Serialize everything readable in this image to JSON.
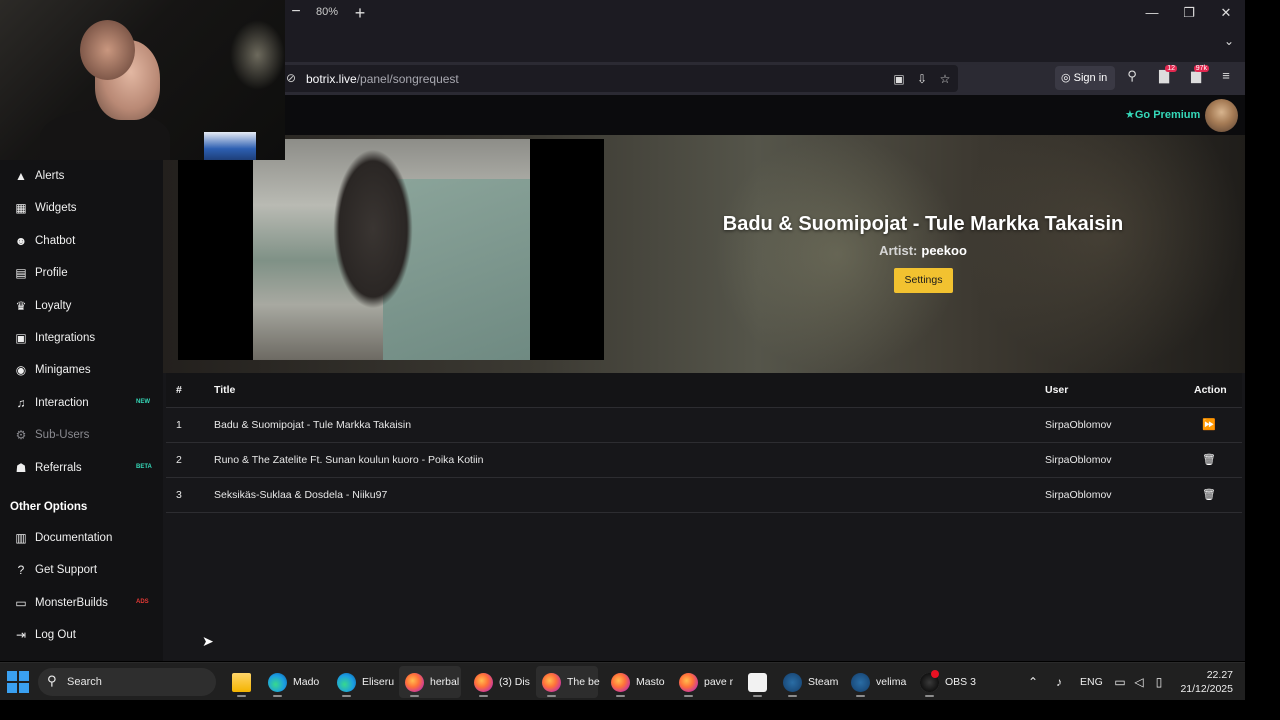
{
  "browser": {
    "zoom": {
      "minus": "−",
      "level": "80%",
      "plus": "+"
    },
    "window_controls": {
      "minimize": "—",
      "restore": "❐",
      "close": "✕"
    },
    "url": {
      "host": "botrix.live",
      "path": "/panel/songrequest"
    },
    "signin_label": "Sign in",
    "badges": {
      "notifications": "12",
      "twitch": "97k"
    }
  },
  "site": {
    "go_premium": "Go Premium"
  },
  "sidebar": {
    "items": [
      {
        "label": "Alerts",
        "icon": "warning-icon",
        "glyph": "▲"
      },
      {
        "label": "Widgets",
        "icon": "widgets-icon",
        "glyph": "▦"
      },
      {
        "label": "Chatbot",
        "icon": "robot-icon",
        "glyph": "☻"
      },
      {
        "label": "Profile",
        "icon": "id-card-icon",
        "glyph": "▤"
      },
      {
        "label": "Loyalty",
        "icon": "trophy-icon",
        "glyph": "♛"
      },
      {
        "label": "Integrations",
        "icon": "plug-icon",
        "glyph": "▣"
      },
      {
        "label": "Minigames",
        "icon": "gamepad-icon",
        "glyph": "◉"
      },
      {
        "label": "Interaction",
        "icon": "music-icon",
        "glyph": "♫",
        "badge": "NEW"
      },
      {
        "label": "Sub-Users",
        "icon": "sub-users-icon",
        "glyph": "⚙",
        "disabled": true
      },
      {
        "label": "Referrals",
        "icon": "users-icon",
        "glyph": "☗",
        "badge": "BETA"
      }
    ],
    "other_options_heading": "Other Options",
    "other_items": [
      {
        "label": "Documentation",
        "icon": "book-icon",
        "glyph": "▥"
      },
      {
        "label": "Get Support",
        "icon": "question-icon",
        "glyph": "?"
      },
      {
        "label": "MonsterBuilds",
        "icon": "laptop-icon",
        "glyph": "▭",
        "badge": "ADS"
      },
      {
        "label": "Log Out",
        "icon": "logout-icon",
        "glyph": "⇥"
      }
    ],
    "badge_colors": {
      "NEW": "#35d9b9",
      "BETA": "#35d9b9",
      "ADS": "#e53935"
    }
  },
  "now_playing": {
    "title": "Badu & Suomipojat - Tule Markka Takaisin",
    "artist_label": "Artist:",
    "artist": "peekoo",
    "settings_label": "Settings"
  },
  "queue": {
    "columns": {
      "num": "#",
      "title": "Title",
      "user": "User",
      "action": "Action"
    },
    "rows": [
      {
        "num": "1",
        "title": "Badu & Suomipojat - Tule Markka Takaisin",
        "user": "SirpaOblomov",
        "action": "skip"
      },
      {
        "num": "2",
        "title": "Runo & The Zatelite Ft. Sunan koulun kuoro - Poika Kotiin",
        "user": "SirpaOblomov",
        "action": "delete"
      },
      {
        "num": "3",
        "title": "Seksikäs-Suklaa & Dosdela - Niiku97",
        "user": "SirpaOblomov",
        "action": "delete"
      }
    ]
  },
  "taskbar": {
    "search_label": "Search",
    "apps": [
      {
        "label": "",
        "icon": "files-icon",
        "cls": "ico-files"
      },
      {
        "label": "Mado",
        "icon": "edge-icon",
        "cls": "ico-edge"
      },
      {
        "label": "Eliseru",
        "icon": "edge-icon",
        "cls": "ico-edge"
      },
      {
        "label": "herbal",
        "icon": "firefox-icon",
        "cls": "ico-firefox",
        "active": true
      },
      {
        "label": "(3) Dis",
        "icon": "firefox-icon",
        "cls": "ico-firefox"
      },
      {
        "label": "The be",
        "icon": "firefox-icon",
        "cls": "ico-firefox",
        "active": true
      },
      {
        "label": "Masto",
        "icon": "firefox-icon",
        "cls": "ico-firefox"
      },
      {
        "label": "pave r",
        "icon": "firefox-icon",
        "cls": "ico-firefox"
      },
      {
        "label": "",
        "icon": "store-icon",
        "cls": "ico-store"
      },
      {
        "label": "Steam",
        "icon": "steam-icon",
        "cls": "ico-steam"
      },
      {
        "label": "velima",
        "icon": "steam-icon",
        "cls": "ico-steam"
      },
      {
        "label": "OBS 3",
        "icon": "obs-icon",
        "cls": "ico-obs"
      }
    ],
    "tray": {
      "language": "ENG",
      "time": "22.27",
      "date": "21/12/2025"
    }
  }
}
